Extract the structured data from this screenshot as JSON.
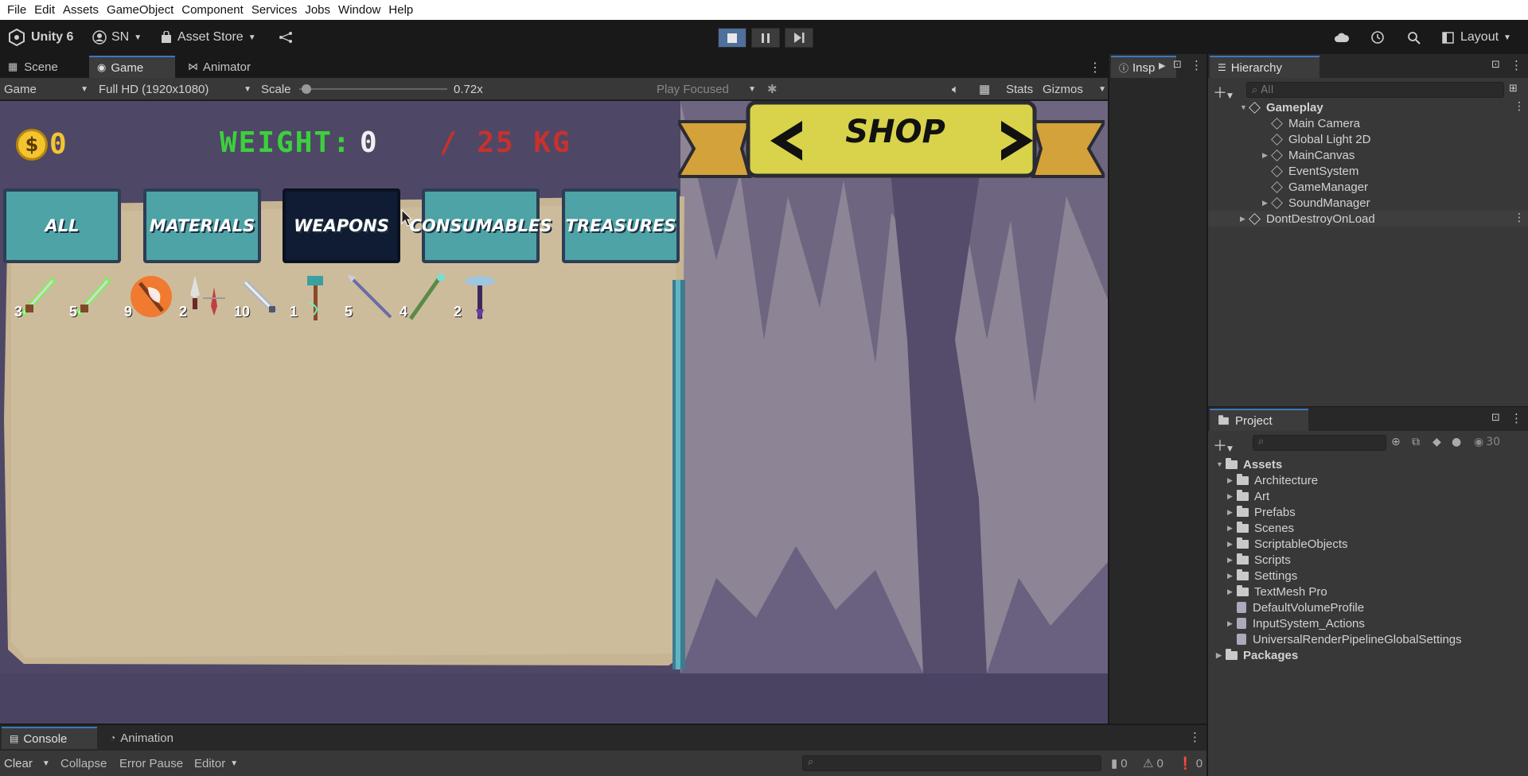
{
  "menu": [
    "File",
    "Edit",
    "Assets",
    "GameObject",
    "Component",
    "Services",
    "Jobs",
    "Window",
    "Help"
  ],
  "toolbar": {
    "app_name": "Unity 6",
    "account": "SN",
    "asset_store": "Asset Store",
    "layout": "Layout"
  },
  "tabs": {
    "scene": "Scene",
    "game": "Game",
    "animator": "Animator",
    "inspector": "Insp",
    "hierarchy": "Hierarchy",
    "project": "Project",
    "console": "Console",
    "animation": "Animation"
  },
  "game_toolbar": {
    "display": "Game",
    "resolution": "Full HD (1920x1080)",
    "scale_label": "Scale",
    "scale_value": "0.72x",
    "scale_level": 0.05,
    "play_mode": "Play Focused",
    "stats": "Stats",
    "gizmos": "Gizmos"
  },
  "game": {
    "coins": "0",
    "weight_label": "WEIGHT:",
    "weight_value": "0",
    "weight_max": "/ 25 KG",
    "shop_title": "SHOP",
    "categories": [
      {
        "label": "ALL",
        "selected": false
      },
      {
        "label": "MATERIALS",
        "selected": false
      },
      {
        "label": "WEAPONS",
        "selected": true
      },
      {
        "label": "CONSUMABLES",
        "selected": false
      },
      {
        "label": "TREASURES",
        "selected": false
      }
    ],
    "items": [
      {
        "name": "green-sword-icon",
        "count": "3"
      },
      {
        "name": "green-sword-icon",
        "count": "5"
      },
      {
        "name": "fire-axe-icon",
        "count": "9"
      },
      {
        "name": "daggers-icon",
        "count": "2"
      },
      {
        "name": "serrated-sword-icon",
        "count": "10"
      },
      {
        "name": "hammer-icon",
        "count": "1"
      },
      {
        "name": "spear-icon",
        "count": "5"
      },
      {
        "name": "staff-icon",
        "count": "4"
      },
      {
        "name": "axe-purple-icon",
        "count": "2"
      }
    ],
    "colors": {
      "weight_label": "#3cd13c",
      "weight_max": "#c9312c",
      "coin": "#f4c430",
      "category": "#4da3a5",
      "category_selected": "#0f1c33"
    }
  },
  "hierarchy": {
    "search_placeholder": "All",
    "rows": [
      {
        "label": "Gameplay",
        "depth": 0,
        "bold": true,
        "expanded": true,
        "kind": "scene"
      },
      {
        "label": "Main Camera",
        "depth": 1,
        "kind": "object"
      },
      {
        "label": "Global Light 2D",
        "depth": 1,
        "kind": "object"
      },
      {
        "label": "MainCanvas",
        "depth": 1,
        "kind": "object",
        "collapsed": true
      },
      {
        "label": "EventSystem",
        "depth": 1,
        "kind": "object"
      },
      {
        "label": "GameManager",
        "depth": 1,
        "kind": "object"
      },
      {
        "label": "SoundManager",
        "depth": 1,
        "kind": "object",
        "collapsed": true
      },
      {
        "label": "DontDestroyOnLoad",
        "depth": 0,
        "kind": "scene",
        "collapsed": true
      }
    ]
  },
  "project": {
    "hidden_count": "30",
    "rows": [
      {
        "label": "Assets",
        "depth": 0,
        "bold": true,
        "expanded": true,
        "kind": "folder"
      },
      {
        "label": "Architecture",
        "depth": 1,
        "kind": "folder"
      },
      {
        "label": "Art",
        "depth": 1,
        "kind": "folder"
      },
      {
        "label": "Prefabs",
        "depth": 1,
        "kind": "folder"
      },
      {
        "label": "Scenes",
        "depth": 1,
        "kind": "folder"
      },
      {
        "label": "ScriptableObjects",
        "depth": 1,
        "kind": "folder"
      },
      {
        "label": "Scripts",
        "depth": 1,
        "kind": "folder"
      },
      {
        "label": "Settings",
        "depth": 1,
        "kind": "folder"
      },
      {
        "label": "TextMesh Pro",
        "depth": 1,
        "kind": "folder"
      },
      {
        "label": "DefaultVolumeProfile",
        "depth": 1,
        "kind": "asset"
      },
      {
        "label": "InputSystem_Actions",
        "depth": 1,
        "kind": "asset"
      },
      {
        "label": "UniversalRenderPipelineGlobalSettings",
        "depth": 1,
        "kind": "asset"
      },
      {
        "label": "Packages",
        "depth": 0,
        "bold": true,
        "kind": "folder",
        "collapsed": true
      }
    ]
  },
  "console": {
    "clear": "Clear",
    "collapse": "Collapse",
    "error_pause": "Error Pause",
    "editor": "Editor",
    "log_count": "0",
    "warn_count": "0",
    "error_count": "0"
  }
}
